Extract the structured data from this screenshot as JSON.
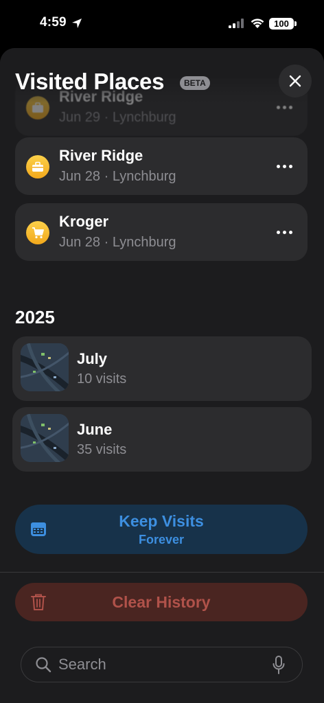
{
  "status_bar": {
    "time": "4:59",
    "battery": "100"
  },
  "sheet": {
    "title": "Visited Places",
    "badge": "BETA"
  },
  "places": [
    {
      "name": "River Ridge",
      "meta": "Jun 29 · Lynchburg",
      "icon": "shopping-bag-icon"
    },
    {
      "name": "River Ridge",
      "meta": "Jun 28 · Lynchburg",
      "icon": "shopping-bag-icon"
    },
    {
      "name": "Kroger",
      "meta": "Jun 28 · Lynchburg",
      "icon": "shopping-cart-icon"
    }
  ],
  "year_section": {
    "year": "2025",
    "months": [
      {
        "name": "July",
        "count": "10 visits"
      },
      {
        "name": "June",
        "count": "35 visits"
      }
    ]
  },
  "keep_visits": {
    "title": "Keep Visits",
    "subtitle": "Forever",
    "icon": "calendar-icon"
  },
  "clear_history": {
    "label": "Clear History",
    "icon": "trash-icon"
  },
  "search": {
    "placeholder": "Search"
  },
  "colors": {
    "accent_blue": "#3d8fe0",
    "destructive": "#b0524a",
    "place_icon": "#f7b928",
    "sheet_bg": "#1c1c1e",
    "card_bg": "#2c2c2e"
  }
}
